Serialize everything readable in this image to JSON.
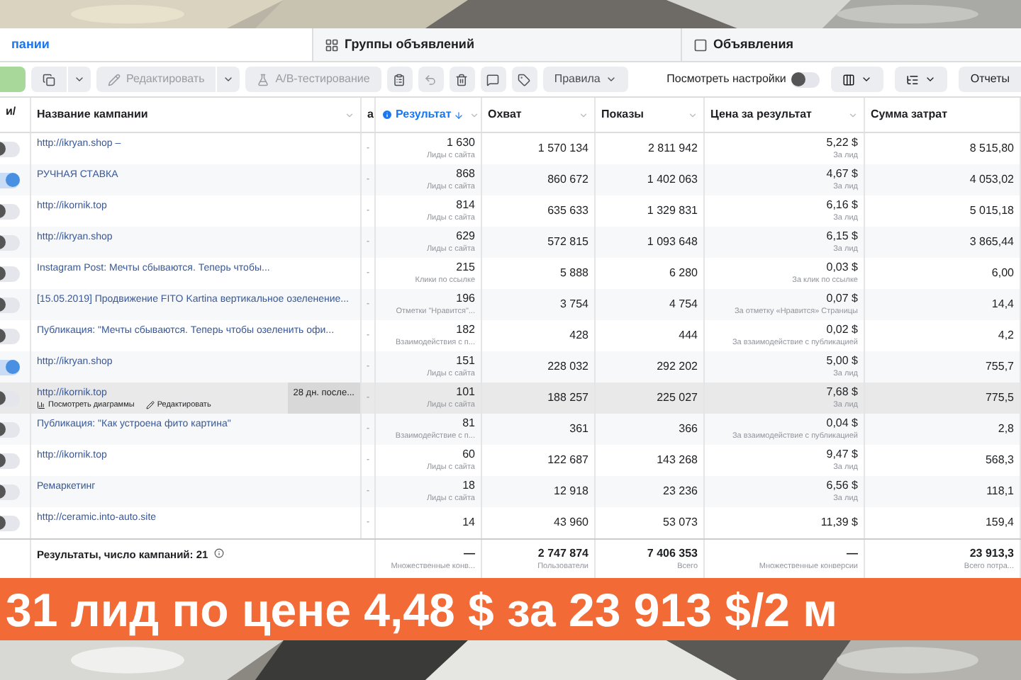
{
  "tabs": [
    {
      "label": "пании",
      "selected": true
    },
    {
      "label": "Группы объявлений",
      "selected": false
    },
    {
      "label": "Объявления",
      "selected": false
    }
  ],
  "toolbar": [
    {
      "kind": "primary",
      "disabled": false
    },
    {
      "kind": "split",
      "disabled": false
    },
    {
      "kind": "split",
      "label": "Редактировать",
      "disabled": true
    },
    {
      "kind": "button",
      "label": "A/B-тестирование",
      "disabled": true
    },
    {
      "kind": "icon",
      "disabled": false
    },
    {
      "kind": "icon",
      "disabled": true
    },
    {
      "kind": "icon",
      "disabled": false
    },
    {
      "kind": "icon",
      "disabled": false
    },
    {
      "kind": "icon",
      "disabled": false
    },
    {
      "kind": "dropdown",
      "label": "Правила",
      "disabled": false
    }
  ],
  "settings_toggle": {
    "label": "Посмотреть настройки",
    "on": false
  },
  "toolbar_right": [
    {
      "kind": "dropdown"
    },
    {
      "kind": "dropdown"
    },
    {
      "kind": "button",
      "label": "Отчеты"
    }
  ],
  "table": {
    "columns": [
      {
        "label": "и/",
        "sorted": false
      },
      {
        "label": "Название кампании",
        "sorted": false
      },
      {
        "label": "а",
        "sorted": false
      },
      {
        "label": "Результат",
        "sorted": true
      },
      {
        "label": "Охват",
        "sorted": false
      },
      {
        "label": "Показы",
        "sorted": false
      },
      {
        "label": "Цена за результат",
        "sorted": false
      },
      {
        "label": "Сумма затрат",
        "sorted": false
      }
    ],
    "rows": [
      {
        "on": false,
        "highlighted": false,
        "name": "http://ikryan.shop –",
        "column_3": "-",
        "result": "1 630",
        "result_label": "Лиды с сайта",
        "reach": "1 570 134",
        "impressions": "2 811 942",
        "cost": "5,22 $",
        "cost_label": "За лид",
        "spent": "8 515,80"
      },
      {
        "on": true,
        "highlighted": false,
        "name": "РУЧНАЯ СТАВКА",
        "column_3": "-",
        "result": "868",
        "result_label": "Лиды с сайта",
        "reach": "860 672",
        "impressions": "1 402 063",
        "cost": "4,67 $",
        "cost_label": "За лид",
        "spent": "4 053,02"
      },
      {
        "on": false,
        "highlighted": false,
        "name": "http://ikornik.top",
        "column_3": "-",
        "result": "814",
        "result_label": "Лиды с сайта",
        "reach": "635 633",
        "impressions": "1 329 831",
        "cost": "6,16 $",
        "cost_label": "За лид",
        "spent": "5 015,18"
      },
      {
        "on": false,
        "highlighted": false,
        "name": "http://ikryan.shop",
        "column_3": "-",
        "result": "629",
        "result_label": "Лиды с сайта",
        "reach": "572 815",
        "impressions": "1 093 648",
        "cost": "6,15 $",
        "cost_label": "За лид",
        "spent": "3 865,44"
      },
      {
        "on": false,
        "highlighted": false,
        "name": "Instagram Post: Мечты сбываются. Теперь чтобы...",
        "column_3": "-",
        "result": "215",
        "result_label": "Клики по ссылке",
        "reach": "5 888",
        "impressions": "6 280",
        "cost": "0,03 $",
        "cost_label": "За клик по ссылке",
        "spent": "6,00"
      },
      {
        "on": false,
        "highlighted": false,
        "name": "[15.05.2019] Продвижение FITO Kartina вертикальное озеленение...",
        "column_3": "-",
        "result": "196",
        "result_label": "Отметки \"Нравится\"...",
        "reach": "3 754",
        "impressions": "4 754",
        "cost": "0,07 $",
        "cost_label": "За отметку «Нравится» Страницы",
        "spent": "14,4"
      },
      {
        "on": false,
        "highlighted": false,
        "name": "Публикация: \"Мечты сбываются. Теперь чтобы озеленить офи...",
        "column_3": "-",
        "result": "182",
        "result_label": "Взаимодействия с п...",
        "reach": "428",
        "impressions": "444",
        "cost": "0,02 $",
        "cost_label": "За взаимодействие с публикацией",
        "spent": "4,2"
      },
      {
        "on": true,
        "highlighted": false,
        "name": "http://ikryan.shop",
        "column_3": "-",
        "result": "151",
        "result_label": "Лиды с сайта",
        "reach": "228 032",
        "impressions": "292 202",
        "cost": "5,00 $",
        "cost_label": "За лид",
        "spent": "755,7"
      },
      {
        "on": false,
        "highlighted": true,
        "name": "http://ikornik.top",
        "actions": [
          "Посмотреть диаграммы",
          "Редактировать"
        ],
        "note": "28 дн. после...",
        "column_3": "-",
        "result": "101",
        "result_label": "Лиды с сайта",
        "reach": "188 257",
        "impressions": "225 027",
        "cost": "7,68 $",
        "cost_label": "За лид",
        "spent": "775,5"
      },
      {
        "on": false,
        "highlighted": false,
        "name": "Публикация: \"Как устроена фито картина\"",
        "column_3": "-",
        "result": "81",
        "result_label": "Взаимодействие с п...",
        "reach": "361",
        "impressions": "366",
        "cost": "0,04 $",
        "cost_label": "За взаимодействие с публикацией",
        "spent": "2,8"
      },
      {
        "on": false,
        "highlighted": false,
        "name": "http://ikornik.top",
        "column_3": "-",
        "result": "60",
        "result_label": "Лиды с сайта",
        "reach": "122 687",
        "impressions": "143 268",
        "cost": "9,47 $",
        "cost_label": "За лид",
        "spent": "568,3"
      },
      {
        "on": false,
        "highlighted": false,
        "name": "Ремаркетинг",
        "column_3": "-",
        "result": "18",
        "result_label": "Лиды с сайта",
        "reach": "12 918",
        "impressions": "23 236",
        "cost": "6,56 $",
        "cost_label": "За лид",
        "spent": "118,1"
      },
      {
        "on": false,
        "highlighted": false,
        "name": "http://ceramic.into-auto.site",
        "column_3": "-",
        "result": "14",
        "reach": "43 960",
        "impressions": "53 073",
        "cost": "11,39 $",
        "spent": "159,4"
      }
    ],
    "footer": {
      "label": "Результаты, число кампаний: 21",
      "result": "—",
      "result_label": "Множественные конв...",
      "reach": "2 747 874",
      "reach_label": "Пользователи",
      "impressions": "7 406 353",
      "impressions_label": "Всего",
      "cost": "—",
      "cost_label": "Множественные конверсии",
      "spent": "23 913,3",
      "spent_label": "Всего потра..."
    }
  },
  "banner": "31 лид по цене 4,48 $ за 23 913 $/2 м"
}
